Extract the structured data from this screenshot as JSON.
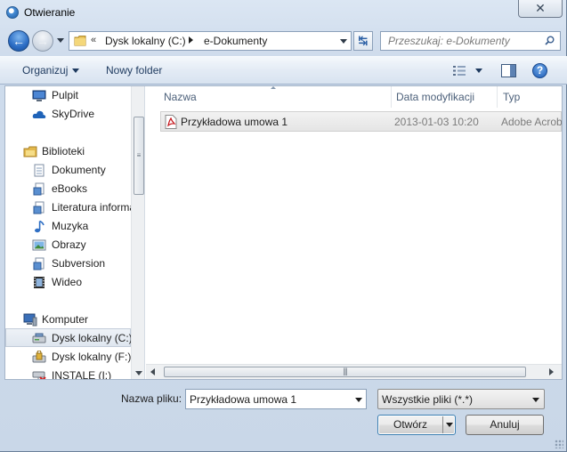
{
  "window": {
    "title": "Otwieranie",
    "close_glyph": "✕"
  },
  "navigation": {
    "back_glyph": "←",
    "forward_glyph": "→",
    "breadcrumb_overflow": "«",
    "breadcrumbs": [
      "Dysk lokalny (C:)",
      "e-Dokumenty"
    ],
    "refresh_glyph": "↹",
    "search_placeholder": "Przeszukaj: e-Dokumenty"
  },
  "toolbar": {
    "organize_label": "Organizuj",
    "new_folder_label": "Nowy folder",
    "help_glyph": "?"
  },
  "sidebar": {
    "items": [
      {
        "label": "Pulpit",
        "icon": "desktop-icon"
      },
      {
        "label": "SkyDrive",
        "icon": "cloud-icon"
      },
      {
        "label": "Biblioteki",
        "icon": "libraries-icon"
      },
      {
        "label": "Dokumenty",
        "icon": "documents-icon"
      },
      {
        "label": "eBooks",
        "icon": "library-folder-icon"
      },
      {
        "label": "Literatura informatyczna",
        "icon": "library-folder-icon"
      },
      {
        "label": "Muzyka",
        "icon": "music-icon"
      },
      {
        "label": "Obrazy",
        "icon": "pictures-icon"
      },
      {
        "label": "Subversion",
        "icon": "library-folder-icon"
      },
      {
        "label": "Wideo",
        "icon": "video-icon"
      },
      {
        "label": "Komputer",
        "icon": "computer-icon"
      },
      {
        "label": "Dysk lokalny (C:)",
        "icon": "drive-icon",
        "selected": true
      },
      {
        "label": "Dysk lokalny (F:)",
        "icon": "drive-locked-icon"
      },
      {
        "label": "INSTALE (I:)",
        "icon": "network-drive-disconnected-icon"
      }
    ]
  },
  "file_list": {
    "columns": [
      "Nazwa",
      "Data modyfikacji",
      "Typ"
    ],
    "rows": [
      {
        "name": "Przykładowa umowa 1",
        "modified": "2013-01-03 10:20",
        "type": "Adobe Acrobat Document",
        "icon": "pdf-icon"
      }
    ]
  },
  "footer": {
    "filename_label": "Nazwa pliku:",
    "filename_value": "Przykładowa umowa 1",
    "filetype_value": "Wszystkie pliki (*.*)",
    "open_label": "Otwórz",
    "cancel_label": "Anuluj"
  },
  "colors": {
    "accent": "#2b6cc4",
    "selection": "#dfe6ef",
    "window_bg": "#cfdcec"
  }
}
